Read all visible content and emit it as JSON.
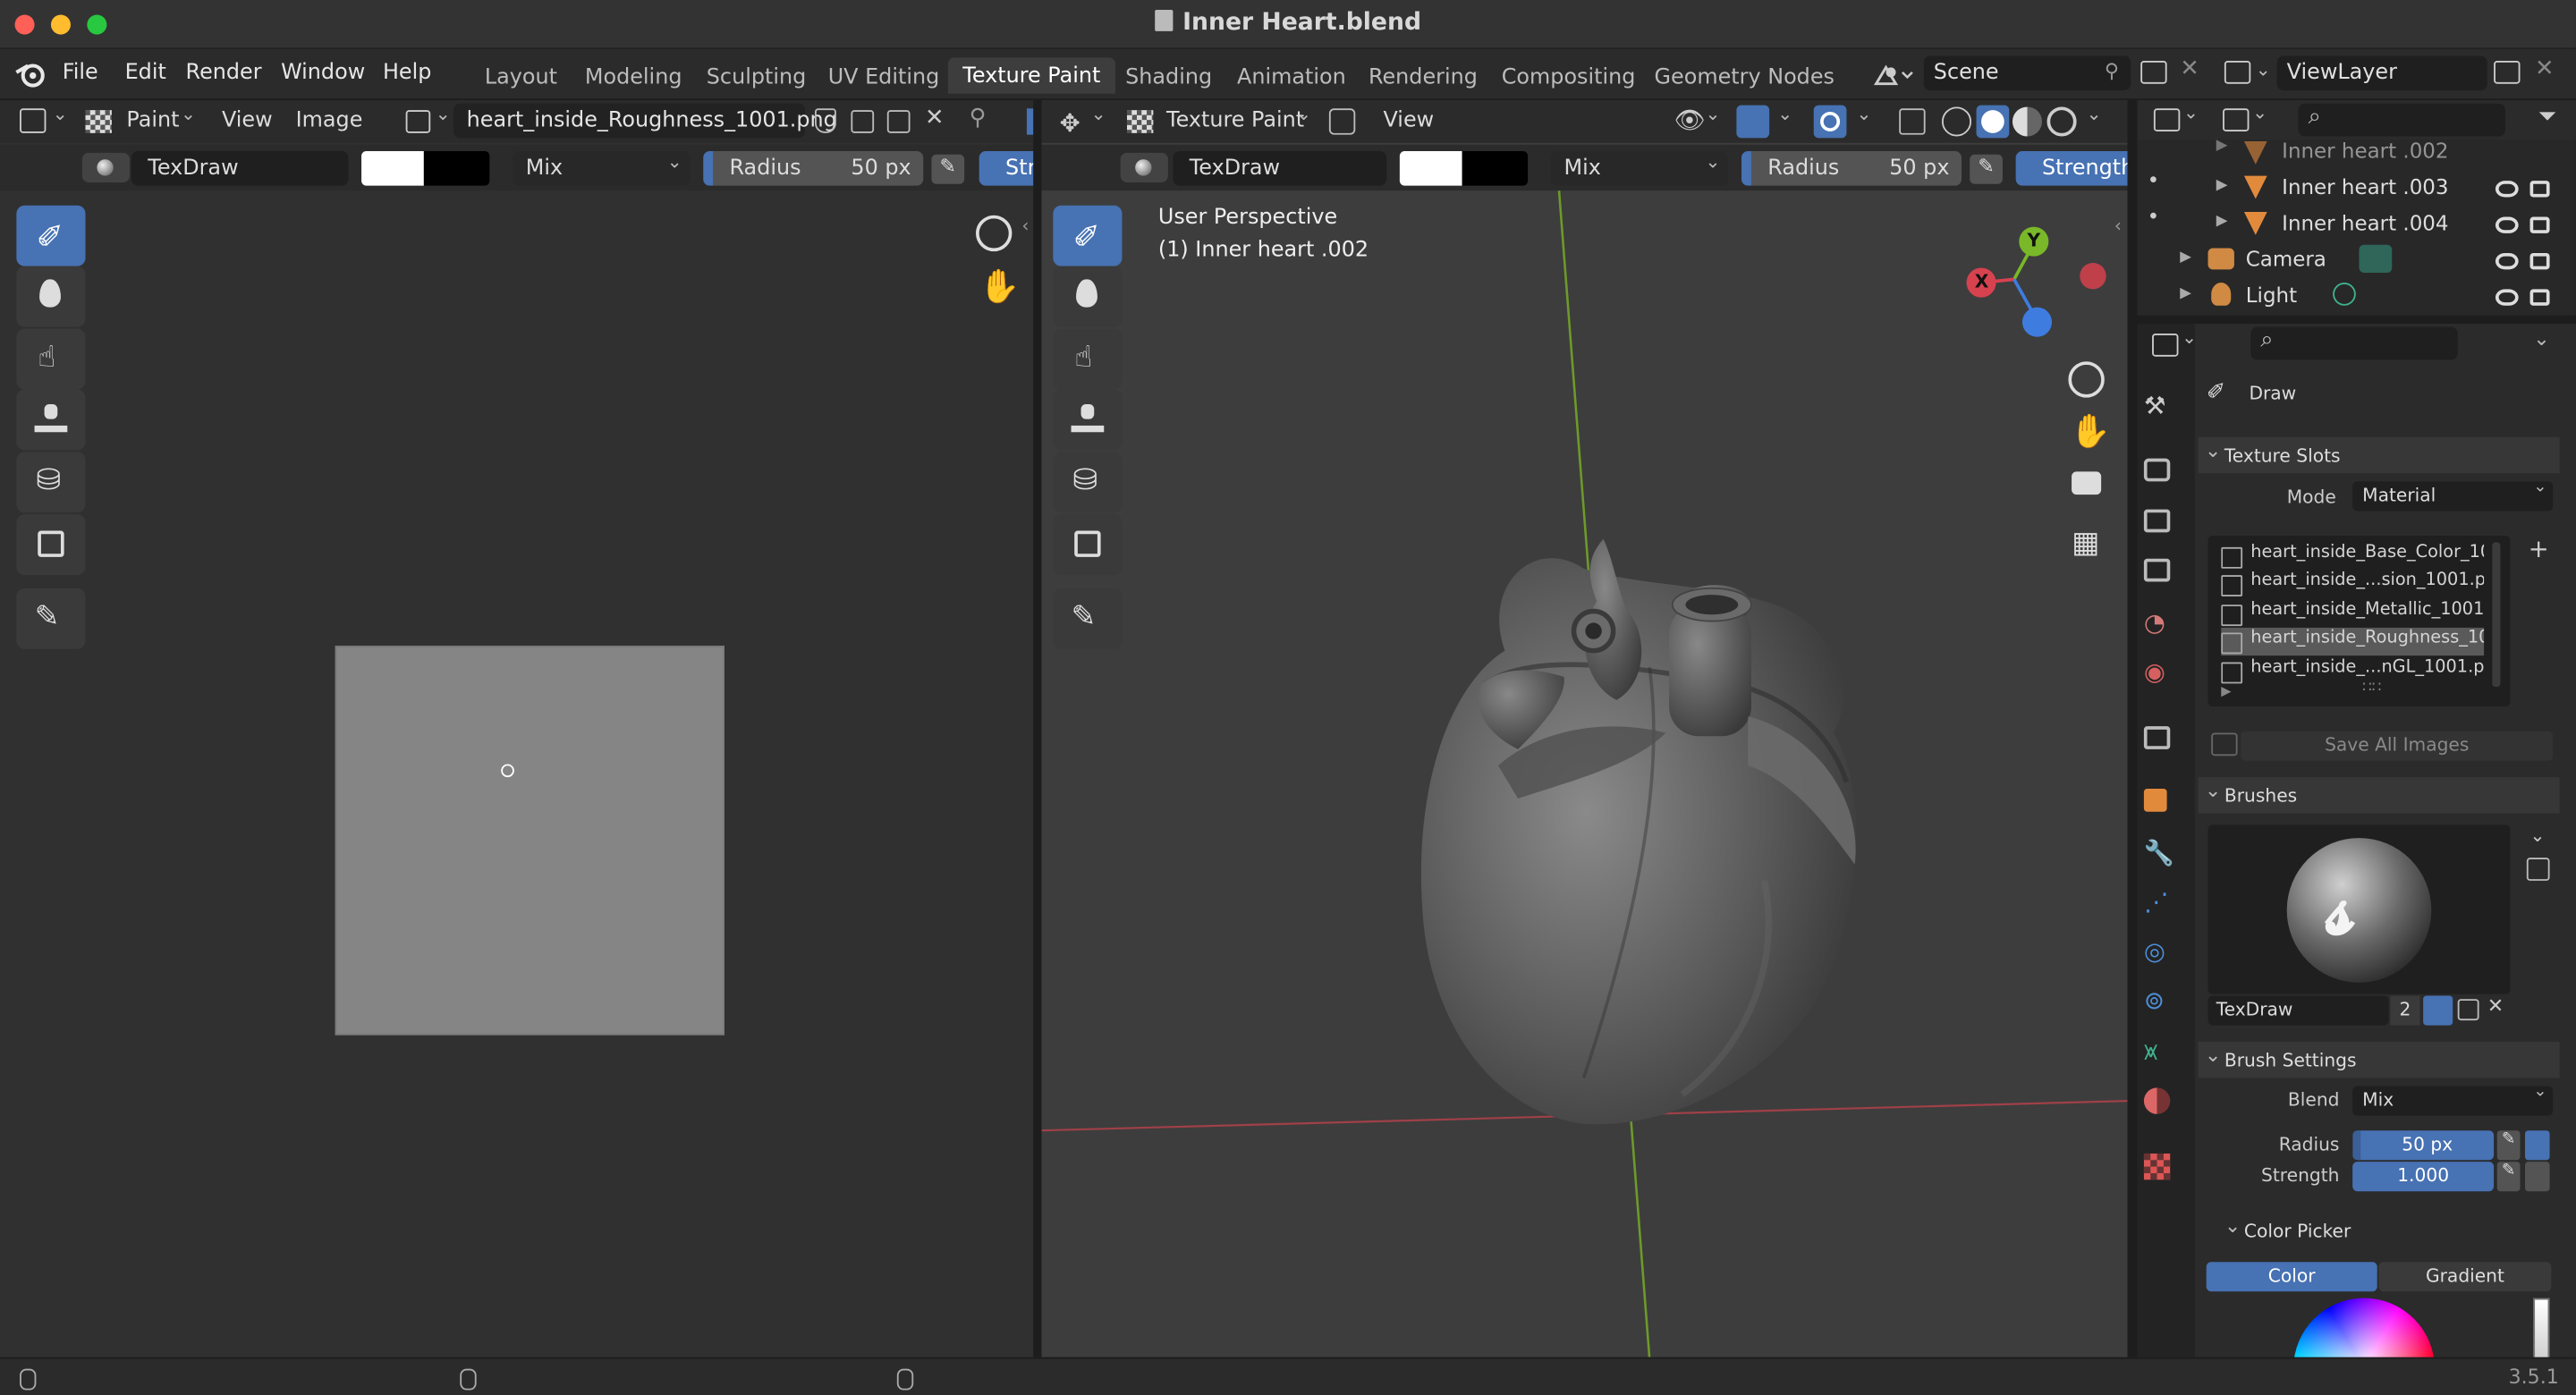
{
  "window": {
    "title": "Inner Heart.blend"
  },
  "menu": [
    "File",
    "Edit",
    "Render",
    "Window",
    "Help"
  ],
  "workspaces": [
    "Layout",
    "Modeling",
    "Sculpting",
    "UV Editing",
    "Texture Paint",
    "Shading",
    "Animation",
    "Rendering",
    "Compositing",
    "Geometry Nodes"
  ],
  "active_workspace": "Texture Paint",
  "scene": "Scene",
  "view_layer": "ViewLayer",
  "image_editor": {
    "mode": "Paint",
    "menus": [
      "View",
      "Image"
    ],
    "image_name": "heart_inside_Roughness_1001.png",
    "brush": "TexDraw",
    "blend": "Mix",
    "radius_label": "Radius",
    "radius_value": "50 px",
    "strength_label": "Str"
  },
  "viewport": {
    "mode": "Texture Paint",
    "menu": "View",
    "brush": "TexDraw",
    "blend": "Mix",
    "radius_label": "Radius",
    "radius_value": "50 px",
    "strength_label": "Strength",
    "overlay_line1": "User Perspective",
    "overlay_line2": "(1) Inner heart .002",
    "gizmo": {
      "x": "X",
      "y": "Y"
    }
  },
  "outliner": {
    "rows": [
      {
        "name": "Inner heart .002",
        "icon": "mesh-icon"
      },
      {
        "name": "Inner heart .003",
        "icon": "mesh-icon"
      },
      {
        "name": "Inner heart .004",
        "icon": "mesh-icon"
      },
      {
        "name": "Camera",
        "icon": "camera-icon"
      },
      {
        "name": "Light",
        "icon": "light-icon"
      }
    ]
  },
  "properties": {
    "tool_name": "Draw",
    "texture_slots": {
      "title": "Texture Slots",
      "mode_label": "Mode",
      "mode_value": "Material",
      "slots": [
        "heart_inside_Base_Color_10...",
        "heart_inside_...sion_1001.png",
        "heart_inside_Metallic_1001....",
        "heart_inside_Roughness_10...",
        "heart_inside_...nGL_1001.png"
      ],
      "selected_index": 3,
      "save_all": "Save All Images"
    },
    "brushes": {
      "title": "Brushes",
      "name": "TexDraw",
      "users": "2"
    },
    "brush_settings": {
      "title": "Brush Settings",
      "blend_label": "Blend",
      "blend_value": "Mix",
      "radius_label": "Radius",
      "radius_value": "50 px",
      "strength_label": "Strength",
      "strength_value": "1.000"
    },
    "color_picker": {
      "title": "Color Picker",
      "tab_color": "Color",
      "tab_gradient": "Gradient"
    }
  },
  "status": {
    "version": "3.5.1"
  },
  "colors": {
    "accent": "#4772b3",
    "x_axis": "#d7424f",
    "y_axis": "#79b828",
    "z_axis": "#3e7ce0"
  }
}
